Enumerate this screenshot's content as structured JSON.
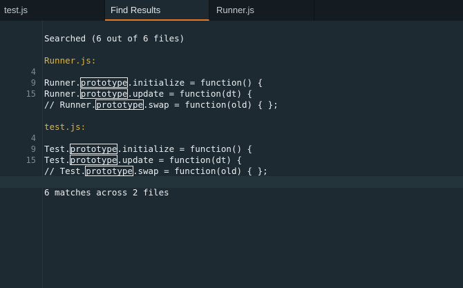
{
  "tabs": [
    {
      "label": "test.js",
      "active": false
    },
    {
      "label": "Find Results",
      "active": true
    },
    {
      "label": "Runner.js",
      "active": false
    }
  ],
  "results": {
    "header": "Searched (6 out of 6 files)",
    "groups": [
      {
        "file": "Runner.js:",
        "lines": [
          {
            "num": "4",
            "before": "Runner.",
            "match": "prototype",
            "after": ".initialize = function() {"
          },
          {
            "num": "9",
            "before": "Runner.",
            "match": "prototype",
            "after": ".update = function(dt) {"
          },
          {
            "num": "15",
            "before": "// Runner.",
            "match": "prototype",
            "after": ".swap = function(old) { };"
          }
        ]
      },
      {
        "file": "test.js:",
        "lines": [
          {
            "num": "4",
            "before": "Test.",
            "match": "prototype",
            "after": ".initialize = function() {"
          },
          {
            "num": "9",
            "before": "Test.",
            "match": "prototype",
            "after": ".update = function(dt) {"
          },
          {
            "num": "15",
            "before": "// Test.",
            "match": "prototype",
            "after": ".swap = function(old) { };"
          }
        ]
      }
    ],
    "summary": "6 matches across 2 files"
  },
  "colors": {
    "background": "#1d2a31",
    "tabbar": "#141c21",
    "active_tab_accent": "#e87b24",
    "filename": "#e2b52d",
    "line_number": "#7b8a91",
    "text": "#e9edef"
  }
}
